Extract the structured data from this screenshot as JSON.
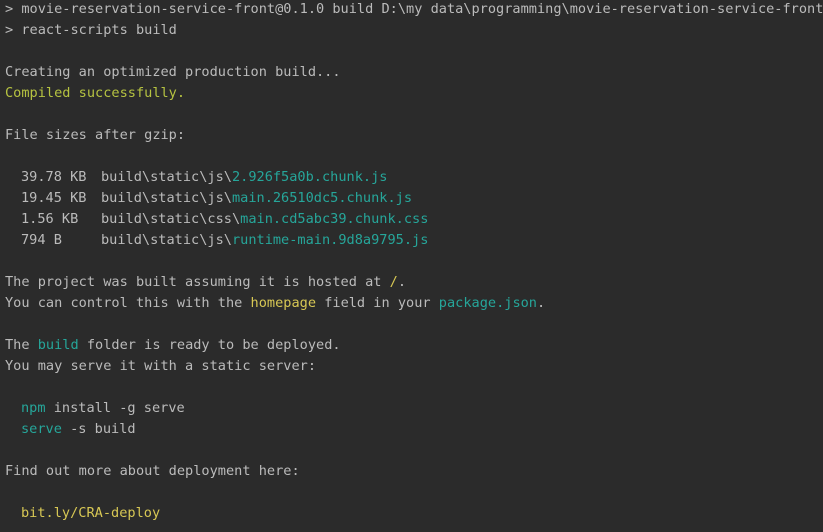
{
  "colors": {
    "background": "#2b2b2b",
    "text": "#bbbbbb",
    "success": "#b6c341",
    "link": "#26a69a",
    "highlight": "#d7c754"
  },
  "lines": {
    "cmd1": "> movie-reservation-service-front@0.1.0 build D:\\my data\\programming\\movie-reservation-service-front",
    "cmd2": "> react-scripts build",
    "creating": "Creating an optimized production build...",
    "compiled": "Compiled successfully.",
    "file_sizes": "File sizes after gzip:",
    "files": [
      {
        "size": "39.78 KB",
        "dir": "build\\static\\js\\",
        "name": "2.926f5a0b.chunk.js"
      },
      {
        "size": "19.45 KB",
        "dir": "build\\static\\js\\",
        "name": "main.26510dc5.chunk.js"
      },
      {
        "size": "1.56 KB",
        "dir": "build\\static\\css\\",
        "name": "main.cd5abc39.chunk.css"
      },
      {
        "size": "794 B",
        "dir": "build\\static\\js\\",
        "name": "runtime-main.9d8a9795.js"
      }
    ],
    "hosted_prefix": "The project was built assuming it is hosted at ",
    "hosted_path": "/",
    "hosted_suffix": ".",
    "control_prefix": "You can control this with the ",
    "control_homepage": "homepage",
    "control_mid": " field in your ",
    "control_pkg": "package.json",
    "control_suffix": ".",
    "build_prefix": "The ",
    "build_word": "build",
    "build_suffix": " folder is ready to be deployed.",
    "serve_line": "You may serve it with a static server:",
    "npm_cmd": "npm",
    "npm_rest": " install -g serve",
    "serve_cmd": "serve",
    "serve_rest": " -s build",
    "find_out": "Find out more about deployment here:",
    "deploy_link": "bit.ly/CRA-deploy"
  }
}
